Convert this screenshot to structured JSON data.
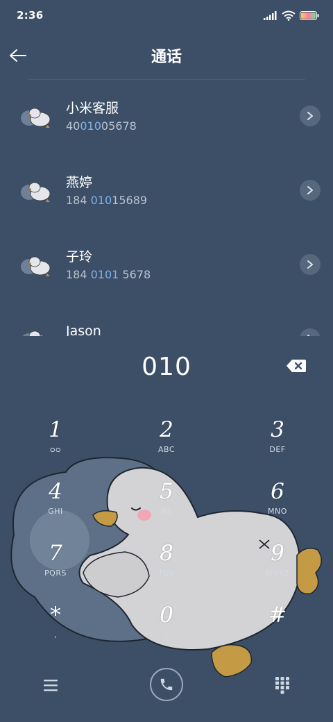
{
  "status": {
    "time": "2:36"
  },
  "header": {
    "title": "通话"
  },
  "contacts": [
    {
      "name": "小米客服",
      "number_pre": "40",
      "number_hl": "010",
      "number_post": "05678"
    },
    {
      "name": "燕婷",
      "number_pre": "184 ",
      "number_hl": "010",
      "number_post": "15689"
    },
    {
      "name": "子玲",
      "number_pre": "184 ",
      "number_hl": "0101",
      "number_post": " 5678"
    },
    {
      "name": "Jason",
      "number_pre": "",
      "number_hl": "",
      "number_post": ""
    }
  ],
  "dialer": {
    "number": "010"
  },
  "keypad": [
    {
      "digit": "1",
      "letters": "ᴑᴑ"
    },
    {
      "digit": "2",
      "letters": "ABC"
    },
    {
      "digit": "3",
      "letters": "DEF"
    },
    {
      "digit": "4",
      "letters": "GHI"
    },
    {
      "digit": "5",
      "letters": "JKL"
    },
    {
      "digit": "6",
      "letters": "MNO"
    },
    {
      "digit": "7",
      "letters": "PQRS"
    },
    {
      "digit": "8",
      "letters": "TUV"
    },
    {
      "digit": "9",
      "letters": "WXYZ"
    },
    {
      "digit": "*",
      "letters": ","
    },
    {
      "digit": "0",
      "letters": "+"
    },
    {
      "digit": "#",
      "letters": ""
    }
  ],
  "colors": {
    "background": "#3d4f67",
    "highlight": "#7fb1e6"
  },
  "icons": {
    "back": "arrow-left-icon",
    "arrow": "chevron-right-icon",
    "backspace": "backspace-icon",
    "menu": "menu-icon",
    "call": "phone-icon",
    "dialpad": "dialpad-icon"
  }
}
